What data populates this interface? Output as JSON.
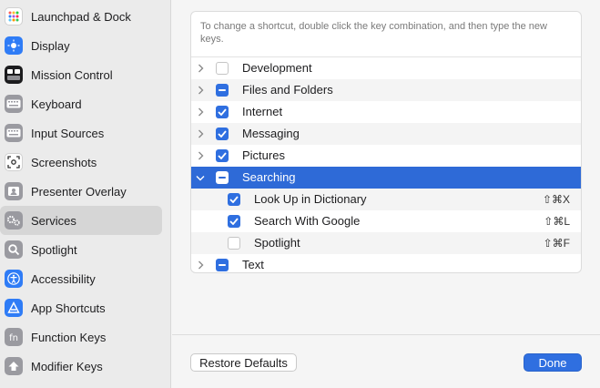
{
  "sidebar": {
    "items": [
      {
        "label": "Launchpad & Dock",
        "icon": "launchpad-icon",
        "color": "#ffffff"
      },
      {
        "label": "Display",
        "icon": "display-icon",
        "color": "#2f7cf6"
      },
      {
        "label": "Mission Control",
        "icon": "mission-control-icon",
        "color": "#1c1c1e"
      },
      {
        "label": "Keyboard",
        "icon": "keyboard-icon",
        "color": "#8e8e93"
      },
      {
        "label": "Input Sources",
        "icon": "input-sources-icon",
        "color": "#8e8e93"
      },
      {
        "label": "Screenshots",
        "icon": "screenshots-icon",
        "color": "#ffffff"
      },
      {
        "label": "Presenter Overlay",
        "icon": "presenter-overlay-icon",
        "color": "#8e8e93"
      },
      {
        "label": "Services",
        "icon": "services-icon",
        "color": "#8e8e93",
        "selected": true
      },
      {
        "label": "Spotlight",
        "icon": "spotlight-icon",
        "color": "#8e8e93"
      },
      {
        "label": "Accessibility",
        "icon": "accessibility-icon",
        "color": "#2f7cf6"
      },
      {
        "label": "App Shortcuts",
        "icon": "app-shortcuts-icon",
        "color": "#2f7cf6"
      },
      {
        "label": "Function Keys",
        "icon": "function-keys-icon",
        "color": "#8e8e93"
      },
      {
        "label": "Modifier Keys",
        "icon": "modifier-keys-icon",
        "color": "#8e8e93"
      }
    ]
  },
  "panel": {
    "hint": "To change a shortcut, double click the key combination, and then type the new keys."
  },
  "tree": [
    {
      "label": "Development",
      "state": "off",
      "expanded": false,
      "level": 0
    },
    {
      "label": "Files and Folders",
      "state": "mixed",
      "expanded": false,
      "level": 0
    },
    {
      "label": "Internet",
      "state": "on",
      "expanded": false,
      "level": 0
    },
    {
      "label": "Messaging",
      "state": "on",
      "expanded": false,
      "level": 0
    },
    {
      "label": "Pictures",
      "state": "on",
      "expanded": false,
      "level": 0
    },
    {
      "label": "Searching",
      "state": "mixed",
      "expanded": true,
      "level": 0,
      "selected": true
    },
    {
      "label": "Look Up in Dictionary",
      "state": "on",
      "level": 1,
      "shortcut": "⇧⌘X"
    },
    {
      "label": "Search With Google",
      "state": "on",
      "level": 1,
      "shortcut": "⇧⌘L"
    },
    {
      "label": "Spotlight",
      "state": "off",
      "level": 1,
      "shortcut": "⇧⌘F"
    },
    {
      "label": "Text",
      "state": "mixed",
      "expanded": false,
      "level": 0
    }
  ],
  "buttons": {
    "restore": "Restore Defaults",
    "done": "Done"
  },
  "colors": {
    "accent": "#2f6fe0",
    "selection": "#2e6ad7"
  }
}
